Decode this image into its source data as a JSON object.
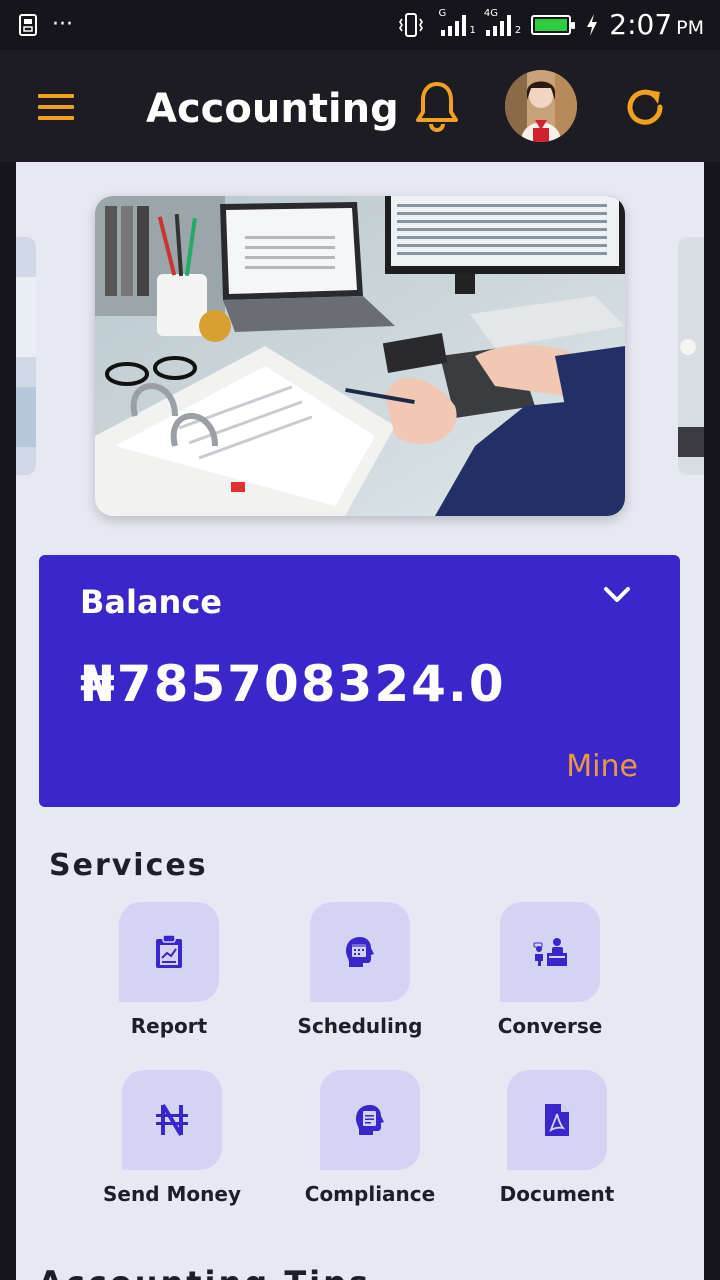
{
  "status_bar": {
    "time": "2:07",
    "ampm": "PM",
    "dots": "···",
    "sim1_label": "G",
    "sim1_sub": "1",
    "sim2_label": "4G",
    "sim2_sub": "2"
  },
  "app_bar": {
    "title": "Accounting"
  },
  "balance": {
    "title": "Balance",
    "amount": "₦785708324.0",
    "owner": "Mine"
  },
  "services": {
    "title": "Services",
    "items": [
      {
        "label": "Report",
        "icon": "clipboard-report-icon"
      },
      {
        "label": "Scheduling",
        "icon": "head-calendar-icon"
      },
      {
        "label": "Converse",
        "icon": "desk-conversation-icon"
      },
      {
        "label": "Send Money",
        "icon": "naira-icon"
      },
      {
        "label": "Compliance",
        "icon": "head-document-icon"
      },
      {
        "label": "Document",
        "icon": "pdf-file-icon"
      }
    ]
  },
  "tips": {
    "title": "Accounting Tips"
  },
  "colors": {
    "accent": "#f2a020",
    "card": "#3a27cc",
    "background": "#e8e8f4",
    "service_tile": "#d4d3f4",
    "icon": "#3a27cc"
  }
}
